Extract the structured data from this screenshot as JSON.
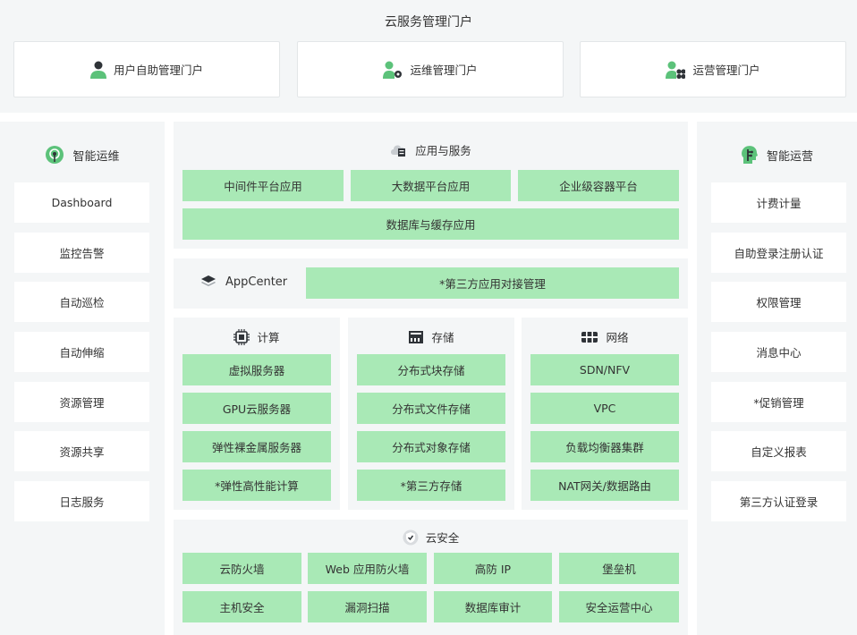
{
  "portal": {
    "title": "云服务管理门户",
    "cards": [
      {
        "label": "用户自助管理门户",
        "icon": "user-icon"
      },
      {
        "label": "运维管理门户",
        "icon": "user-gear-icon"
      },
      {
        "label": "运营管理门户",
        "icon": "user-group-icon"
      }
    ]
  },
  "left": {
    "title": "智能运维",
    "icon": "signal-tower-icon",
    "items": [
      "Dashboard",
      "监控告警",
      "自动巡检",
      "自动伸缩",
      "资源管理",
      "资源共享",
      "日志服务"
    ]
  },
  "right": {
    "title": "智能运营",
    "icon": "ai-head-icon",
    "items": [
      "计费计量",
      "自助登录注册认证",
      "权限管理",
      "消息中心",
      "*促销管理",
      "自定义报表",
      "第三方认证登录"
    ]
  },
  "apps": {
    "title": "应用与服务",
    "icon": "cloud-server-icon",
    "row1": [
      "中间件平台应用",
      "大数据平台应用",
      "企业级容器平台"
    ],
    "row2": "数据库与缓存应用"
  },
  "appcenter": {
    "title": "AppCenter",
    "icon": "layers-icon",
    "item": "*第三方应用对接管理"
  },
  "compute": {
    "title": "计算",
    "icon": "chip-icon",
    "items": [
      "虚拟服务器",
      "GPU云服务器",
      "弹性裸金属服务器",
      "*弹性高性能计算"
    ]
  },
  "storage": {
    "title": "存储",
    "icon": "storage-icon",
    "items": [
      "分布式块存储",
      "分布式文件存储",
      "分布式对象存储",
      "*第三方存储"
    ]
  },
  "network": {
    "title": "网络",
    "icon": "network-icon",
    "items": [
      "SDN/NFV",
      "VPC",
      "负载均衡器集群",
      "NAT网关/数据路由"
    ]
  },
  "security": {
    "title": "云安全",
    "icon": "shield-check-icon",
    "row1": [
      "云防火墙",
      "Web 应用防火墙",
      "高防 IP",
      "堡垒机"
    ],
    "row2": [
      "主机安全",
      "漏洞扫描",
      "数据库审计",
      "安全运营中心"
    ]
  },
  "colors": {
    "accent": "#5cc27a",
    "box_fill": "#a9e9b6",
    "panel_bg": "#f4f6f7",
    "icon_dark": "#555a60"
  }
}
